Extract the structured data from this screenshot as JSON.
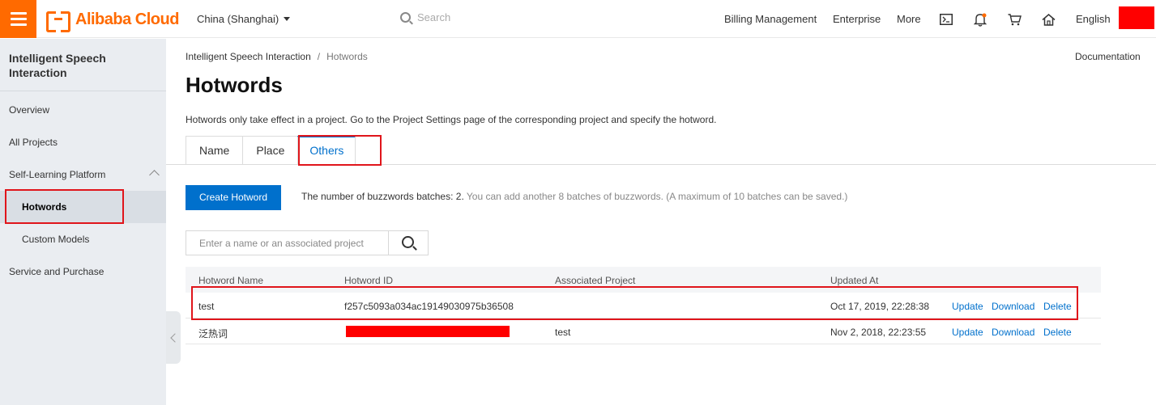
{
  "header": {
    "brand": "Alibaba Cloud",
    "region": "China (Shanghai)",
    "search_placeholder": "Search",
    "nav": [
      "Billing Management",
      "Enterprise",
      "More"
    ],
    "language": "English",
    "icons": [
      "terminal-icon",
      "bell-icon",
      "cart-icon",
      "home-icon"
    ]
  },
  "sidebar": {
    "title": "Intelligent Speech Interaction",
    "items": [
      {
        "label": "Overview"
      },
      {
        "label": "All Projects"
      },
      {
        "label": "Self-Learning Platform"
      },
      {
        "label": "Hotwords"
      },
      {
        "label": "Custom Models"
      },
      {
        "label": "Service and Purchase"
      }
    ]
  },
  "breadcrumb": {
    "root": "Intelligent Speech Interaction",
    "sep": "/",
    "current": "Hotwords"
  },
  "documentation": "Documentation",
  "page": {
    "title": "Hotwords",
    "description": "Hotwords only take effect in a project. Go to the Project Settings page of the corresponding project and specify the hotword."
  },
  "tabs": [
    "Name",
    "Place",
    "Others"
  ],
  "active_tab": "Others",
  "create_button": "Create Hotword",
  "batch_info": {
    "main": "The number of buzzwords batches: 2.",
    "note": " You can add another 8 batches of buzzwords. (A maximum of 10 batches can be saved.)"
  },
  "search_input": {
    "placeholder": "Enter a name or an associated project",
    "value": ""
  },
  "table": {
    "columns": [
      "Hotword Name",
      "Hotword ID",
      "Associated Project",
      "Updated At"
    ],
    "rows": [
      {
        "name": "test",
        "id": "f257c5093a034ac19149030975b36508",
        "project": "",
        "updated": "Oct 17, 2019, 22:28:38"
      },
      {
        "name": "泛热词",
        "id": "",
        "project": "test",
        "updated": "Nov 2, 2018, 22:23:55"
      }
    ],
    "actions": [
      "Update",
      "Download",
      "Delete"
    ]
  },
  "colors": {
    "brand": "#ff6a00",
    "primary": "#0070cc",
    "highlight": "#e0151b",
    "sidebar_bg": "#eaedf1"
  }
}
